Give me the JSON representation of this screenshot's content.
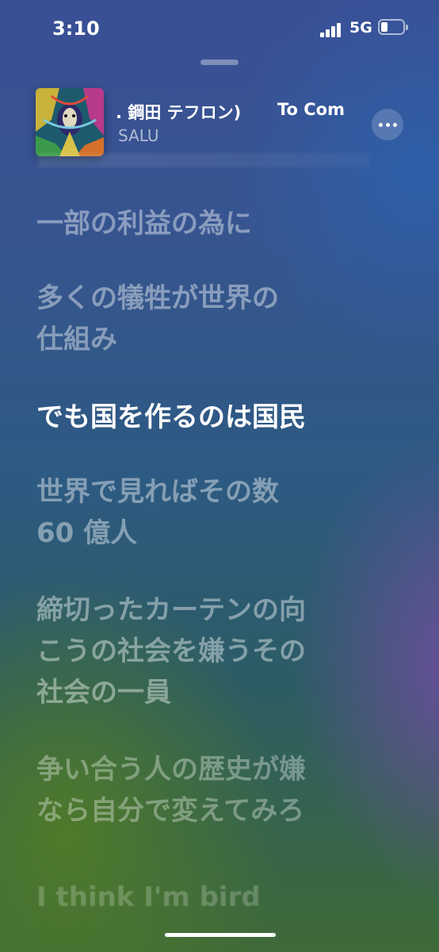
{
  "status": {
    "time": "3:10",
    "network": "5G"
  },
  "now_playing": {
    "title_fragment": "t. 鋼田 テフロン)",
    "title_next": "To Com",
    "artist": "SALU"
  },
  "lyrics": [
    "一部の利益の為に",
    "多くの犠牲が世界の\n仕組み",
    "でも国を作るのは国民",
    "世界で見ればその数\n60 億人",
    "締切ったカーテンの向\nこうの社会を嫌うその\n社会の一員",
    "争い合う人の歴史が嫌\nなら自分で変えてみろ",
    "I think I'm bird"
  ]
}
